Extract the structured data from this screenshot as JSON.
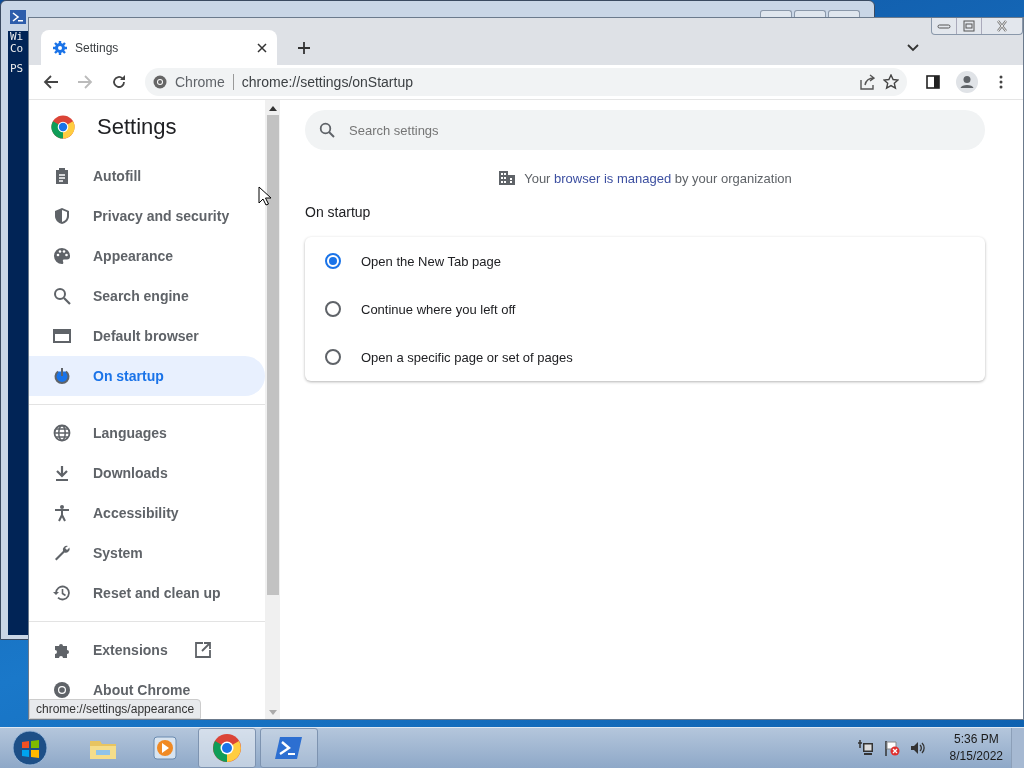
{
  "background_window": {
    "console_lines": [
      "Wi",
      "Co",
      "PS"
    ]
  },
  "browser": {
    "tabs": [
      {
        "title": "Settings",
        "selected": true
      }
    ],
    "address_bar": {
      "site_label": "Chrome",
      "url": "chrome://settings/onStartup"
    },
    "sidebar": {
      "title": "Settings",
      "groups": [
        [
          {
            "label": "Autofill",
            "selected": false,
            "kind": "page"
          },
          {
            "label": "Privacy and security",
            "selected": false,
            "kind": "page"
          },
          {
            "label": "Appearance",
            "selected": false,
            "kind": "page"
          },
          {
            "label": "Search engine",
            "selected": false,
            "kind": "page"
          },
          {
            "label": "Default browser",
            "selected": false,
            "kind": "page"
          },
          {
            "label": "On startup",
            "selected": true,
            "kind": "page"
          }
        ],
        [
          {
            "label": "Languages",
            "selected": false,
            "kind": "page"
          },
          {
            "label": "Downloads",
            "selected": false,
            "kind": "page"
          },
          {
            "label": "Accessibility",
            "selected": false,
            "kind": "page"
          },
          {
            "label": "System",
            "selected": false,
            "kind": "page"
          },
          {
            "label": "Reset and clean up",
            "selected": false,
            "kind": "page"
          }
        ],
        [
          {
            "label": "Extensions",
            "selected": false,
            "kind": "external"
          },
          {
            "label": "About Chrome",
            "selected": false,
            "kind": "page"
          }
        ]
      ]
    },
    "search": {
      "placeholder": "Search settings"
    },
    "managed_notice": {
      "before": "Your",
      "link": "browser is managed",
      "after": "by your organization"
    },
    "section_title": "On startup",
    "startup_options": [
      {
        "label": "Open the New Tab page",
        "selected": true
      },
      {
        "label": "Continue where you left off",
        "selected": false
      },
      {
        "label": "Open a specific page or set of pages",
        "selected": false
      }
    ],
    "status_bubble": "chrome://settings/appearance"
  },
  "taskbar": {
    "apps": [
      {
        "kind": "explorer",
        "active": false
      },
      {
        "kind": "media",
        "active": false
      },
      {
        "kind": "chrome",
        "active": true
      },
      {
        "kind": "powershell",
        "active": false
      }
    ],
    "time": "5:36 PM",
    "date": "8/15/2022"
  }
}
